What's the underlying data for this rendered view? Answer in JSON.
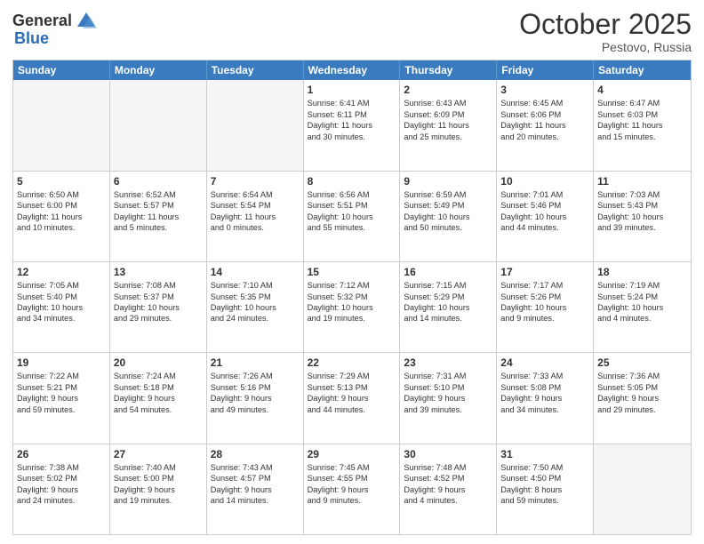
{
  "header": {
    "logo_general": "General",
    "logo_blue": "Blue",
    "month": "October 2025",
    "location": "Pestovo, Russia"
  },
  "weekdays": [
    "Sunday",
    "Monday",
    "Tuesday",
    "Wednesday",
    "Thursday",
    "Friday",
    "Saturday"
  ],
  "rows": [
    [
      {
        "day": "",
        "empty": true
      },
      {
        "day": "",
        "empty": true
      },
      {
        "day": "",
        "empty": true
      },
      {
        "day": "1",
        "lines": [
          "Sunrise: 6:41 AM",
          "Sunset: 6:11 PM",
          "Daylight: 11 hours",
          "and 30 minutes."
        ]
      },
      {
        "day": "2",
        "lines": [
          "Sunrise: 6:43 AM",
          "Sunset: 6:09 PM",
          "Daylight: 11 hours",
          "and 25 minutes."
        ]
      },
      {
        "day": "3",
        "lines": [
          "Sunrise: 6:45 AM",
          "Sunset: 6:06 PM",
          "Daylight: 11 hours",
          "and 20 minutes."
        ]
      },
      {
        "day": "4",
        "lines": [
          "Sunrise: 6:47 AM",
          "Sunset: 6:03 PM",
          "Daylight: 11 hours",
          "and 15 minutes."
        ]
      }
    ],
    [
      {
        "day": "5",
        "lines": [
          "Sunrise: 6:50 AM",
          "Sunset: 6:00 PM",
          "Daylight: 11 hours",
          "and 10 minutes."
        ]
      },
      {
        "day": "6",
        "lines": [
          "Sunrise: 6:52 AM",
          "Sunset: 5:57 PM",
          "Daylight: 11 hours",
          "and 5 minutes."
        ]
      },
      {
        "day": "7",
        "lines": [
          "Sunrise: 6:54 AM",
          "Sunset: 5:54 PM",
          "Daylight: 11 hours",
          "and 0 minutes."
        ]
      },
      {
        "day": "8",
        "lines": [
          "Sunrise: 6:56 AM",
          "Sunset: 5:51 PM",
          "Daylight: 10 hours",
          "and 55 minutes."
        ]
      },
      {
        "day": "9",
        "lines": [
          "Sunrise: 6:59 AM",
          "Sunset: 5:49 PM",
          "Daylight: 10 hours",
          "and 50 minutes."
        ]
      },
      {
        "day": "10",
        "lines": [
          "Sunrise: 7:01 AM",
          "Sunset: 5:46 PM",
          "Daylight: 10 hours",
          "and 44 minutes."
        ]
      },
      {
        "day": "11",
        "lines": [
          "Sunrise: 7:03 AM",
          "Sunset: 5:43 PM",
          "Daylight: 10 hours",
          "and 39 minutes."
        ]
      }
    ],
    [
      {
        "day": "12",
        "lines": [
          "Sunrise: 7:05 AM",
          "Sunset: 5:40 PM",
          "Daylight: 10 hours",
          "and 34 minutes."
        ]
      },
      {
        "day": "13",
        "lines": [
          "Sunrise: 7:08 AM",
          "Sunset: 5:37 PM",
          "Daylight: 10 hours",
          "and 29 minutes."
        ]
      },
      {
        "day": "14",
        "lines": [
          "Sunrise: 7:10 AM",
          "Sunset: 5:35 PM",
          "Daylight: 10 hours",
          "and 24 minutes."
        ]
      },
      {
        "day": "15",
        "lines": [
          "Sunrise: 7:12 AM",
          "Sunset: 5:32 PM",
          "Daylight: 10 hours",
          "and 19 minutes."
        ]
      },
      {
        "day": "16",
        "lines": [
          "Sunrise: 7:15 AM",
          "Sunset: 5:29 PM",
          "Daylight: 10 hours",
          "and 14 minutes."
        ]
      },
      {
        "day": "17",
        "lines": [
          "Sunrise: 7:17 AM",
          "Sunset: 5:26 PM",
          "Daylight: 10 hours",
          "and 9 minutes."
        ]
      },
      {
        "day": "18",
        "lines": [
          "Sunrise: 7:19 AM",
          "Sunset: 5:24 PM",
          "Daylight: 10 hours",
          "and 4 minutes."
        ]
      }
    ],
    [
      {
        "day": "19",
        "lines": [
          "Sunrise: 7:22 AM",
          "Sunset: 5:21 PM",
          "Daylight: 9 hours",
          "and 59 minutes."
        ]
      },
      {
        "day": "20",
        "lines": [
          "Sunrise: 7:24 AM",
          "Sunset: 5:18 PM",
          "Daylight: 9 hours",
          "and 54 minutes."
        ]
      },
      {
        "day": "21",
        "lines": [
          "Sunrise: 7:26 AM",
          "Sunset: 5:16 PM",
          "Daylight: 9 hours",
          "and 49 minutes."
        ]
      },
      {
        "day": "22",
        "lines": [
          "Sunrise: 7:29 AM",
          "Sunset: 5:13 PM",
          "Daylight: 9 hours",
          "and 44 minutes."
        ]
      },
      {
        "day": "23",
        "lines": [
          "Sunrise: 7:31 AM",
          "Sunset: 5:10 PM",
          "Daylight: 9 hours",
          "and 39 minutes."
        ]
      },
      {
        "day": "24",
        "lines": [
          "Sunrise: 7:33 AM",
          "Sunset: 5:08 PM",
          "Daylight: 9 hours",
          "and 34 minutes."
        ]
      },
      {
        "day": "25",
        "lines": [
          "Sunrise: 7:36 AM",
          "Sunset: 5:05 PM",
          "Daylight: 9 hours",
          "and 29 minutes."
        ]
      }
    ],
    [
      {
        "day": "26",
        "lines": [
          "Sunrise: 7:38 AM",
          "Sunset: 5:02 PM",
          "Daylight: 9 hours",
          "and 24 minutes."
        ]
      },
      {
        "day": "27",
        "lines": [
          "Sunrise: 7:40 AM",
          "Sunset: 5:00 PM",
          "Daylight: 9 hours",
          "and 19 minutes."
        ]
      },
      {
        "day": "28",
        "lines": [
          "Sunrise: 7:43 AM",
          "Sunset: 4:57 PM",
          "Daylight: 9 hours",
          "and 14 minutes."
        ]
      },
      {
        "day": "29",
        "lines": [
          "Sunrise: 7:45 AM",
          "Sunset: 4:55 PM",
          "Daylight: 9 hours",
          "and 9 minutes."
        ]
      },
      {
        "day": "30",
        "lines": [
          "Sunrise: 7:48 AM",
          "Sunset: 4:52 PM",
          "Daylight: 9 hours",
          "and 4 minutes."
        ]
      },
      {
        "day": "31",
        "lines": [
          "Sunrise: 7:50 AM",
          "Sunset: 4:50 PM",
          "Daylight: 8 hours",
          "and 59 minutes."
        ]
      },
      {
        "day": "",
        "empty": true
      }
    ]
  ]
}
